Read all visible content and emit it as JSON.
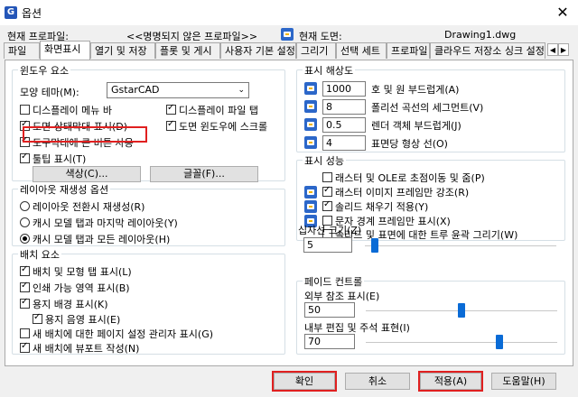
{
  "window": {
    "title": "옵션",
    "close": "✕"
  },
  "info": {
    "profile_label": "현재 프로파일:",
    "profile_value": "<<명명되지 않은 프로파일>>",
    "drawing_label": "현재 도면:",
    "drawing_value": "Drawing1.dwg"
  },
  "tabs": [
    "파일",
    "화면표시",
    "열기 및 저장",
    "플롯 및 게시",
    "사용자 기본 설정",
    "그리기",
    "선택 세트",
    "프로파일",
    "클라우드 저장소 싱크 설정"
  ],
  "tab_scroll": {
    "left": "◀",
    "right": "▶"
  },
  "window_elements": {
    "title": "윈도우 요소",
    "theme_label": "모양 테마(M):",
    "theme_value": "GstarCAD",
    "theme_arrow": "⌄",
    "chk_menu_bar": "디스플레이 메뉴 바",
    "chk_file_tabs": "디스플레이 파일 탭",
    "chk_status_bar": "도면 상태막대 표시(D)",
    "chk_scrollbars": "도면 윈도우에 스크롤",
    "chk_large_buttons": "도구막대에 큰 버튼 사용",
    "chk_tooltips": "툴팁 표시(T)",
    "colors_button": "색상(C)...",
    "fonts_button": "글꼴(F)..."
  },
  "layout_regen": {
    "title": "레이아웃 재생성 옵션",
    "opt1": "레이아웃 전환시 재생성(R)",
    "opt2": "캐시 모델 탭과 마지막 레이아웃(Y)",
    "opt3": "캐시 모델 탭과 모든 레이아웃(H)"
  },
  "layout_elements": {
    "title": "배치 요소",
    "chk1": "배치 및 모형 탭 표시(L)",
    "chk2": "인쇄 가능 영역 표시(B)",
    "chk3": "용지 배경 표시(K)",
    "chk3a": "용지 음영 표시(E)",
    "chk4": "새 배치에 대한 페이지 설정 관리자 표시(G)",
    "chk5": "새 배치에 뷰포트 작성(N)"
  },
  "resolution": {
    "title": "표시 해상도",
    "r1_value": "1000",
    "r1_label": "호 및 원 부드럽게(A)",
    "r2_value": "8",
    "r2_label": "폴리선 곡선의 세그먼트(V)",
    "r3_value": "0.5",
    "r3_label": "렌더 객체 부드럽게(J)",
    "r4_value": "4",
    "r4_label": "표면당 형상 선(O)"
  },
  "performance": {
    "title": "표시 성능",
    "chk1": "래스터 및 OLE로 초점이동 및 줌(P)",
    "chk2": "래스터 이미지 프레임만 강조(R)",
    "chk3": "솔리드 채우기 적용(Y)",
    "chk4": "문자 경계 프레임만 표시(X)",
    "chk5": "솔리드 및 표면에 대한 트루 윤곽 그리기(W)"
  },
  "crosshair": {
    "title": "십자선 크기(Z)",
    "value": "5",
    "level_percent": 5
  },
  "fade": {
    "title": "페이드 컨트롤",
    "xref_label": "외부 참조 표시(E)",
    "xref_value": "50",
    "xref_level_percent": 50,
    "inplace_label": "내부 편집 및 주석 표현(I)",
    "inplace_value": "70",
    "inplace_level_percent": 70
  },
  "footer": {
    "ok": "확인",
    "cancel": "취소",
    "apply": "적용(A)",
    "help": "도움말(H)"
  },
  "colors": {
    "highlight": "#e02020",
    "accent": "#0a6bd6"
  }
}
